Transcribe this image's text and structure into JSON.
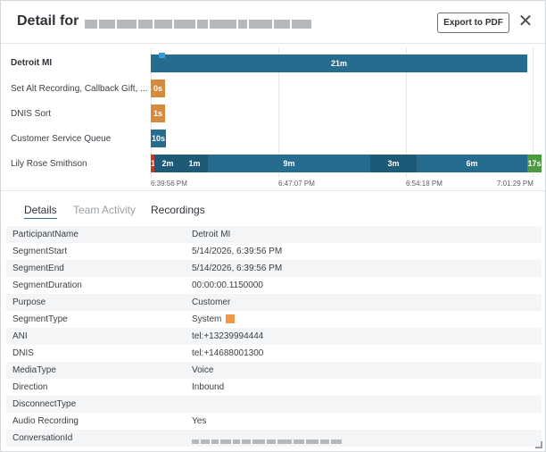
{
  "header": {
    "title": "Detail for",
    "export_label": "Export to PDF",
    "close_label": "✕"
  },
  "timeline": {
    "rows": [
      {
        "label": "Detroit MI",
        "bars": [
          {
            "text": "21m"
          }
        ]
      },
      {
        "label": "Set Alt Recording, Callback Gift, ...",
        "bars": [
          {
            "text": "0s"
          }
        ]
      },
      {
        "label": "DNIS Sort",
        "bars": [
          {
            "text": "1s"
          }
        ]
      },
      {
        "label": "Customer Service Queue",
        "bars": [
          {
            "text": "10s"
          }
        ]
      },
      {
        "label": "Lily Rose Smithson",
        "bars": [
          {
            "text": "1"
          },
          {
            "text": "2m"
          },
          {
            "text": "1m"
          },
          {
            "text": "9m"
          },
          {
            "text": "3m"
          },
          {
            "text": "6m"
          },
          {
            "text": "17s"
          }
        ]
      }
    ],
    "ticks": [
      "6:39:56 PM",
      "6:47:07 PM",
      "6:54:18 PM",
      "7:01:29 PM"
    ]
  },
  "tabs": [
    {
      "label": "Details",
      "active": true
    },
    {
      "label": "Team Activity",
      "active": false
    },
    {
      "label": "Recordings",
      "active": false
    }
  ],
  "details": [
    {
      "key": "ParticipantName",
      "value": "Detroit MI"
    },
    {
      "key": "SegmentStart",
      "value": "5/14/2026, 6:39:56 PM"
    },
    {
      "key": "SegmentEnd",
      "value": "5/14/2026, 6:39:56 PM"
    },
    {
      "key": "SegmentDuration",
      "value": "00:00:00.1150000"
    },
    {
      "key": "Purpose",
      "value": "Customer"
    },
    {
      "key": "SegmentType",
      "value": "System"
    },
    {
      "key": "ANI",
      "value": "tel:+13239994444"
    },
    {
      "key": "DNIS",
      "value": "tel:+14688001300"
    },
    {
      "key": "MediaType",
      "value": "Voice"
    },
    {
      "key": "Direction",
      "value": "Inbound"
    },
    {
      "key": "DisconnectType",
      "value": ""
    },
    {
      "key": "Audio Recording",
      "value": "Yes"
    },
    {
      "key": "ConversationId",
      "value": ""
    }
  ],
  "colors": {
    "bar_blue": "#266c8f",
    "bar_orange": "#d58a3c",
    "bar_red": "#c0392b",
    "bar_green": "#4c9a3f",
    "segment_type_swatch": "#ef9a4a"
  }
}
